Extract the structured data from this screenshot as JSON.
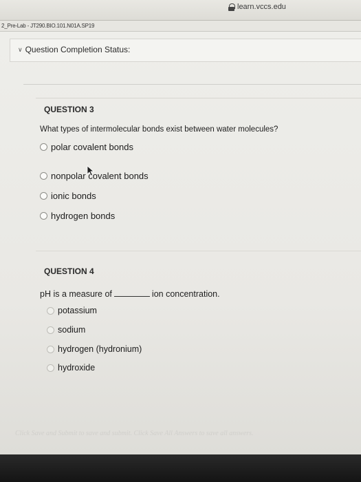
{
  "browser": {
    "url": "learn.vccs.edu"
  },
  "breadcrumb": "2_Pre-Lab - JT290.BIO.101.N01A.SP19",
  "status": {
    "label": "Question Completion Status:"
  },
  "question3": {
    "heading": "QUESTION 3",
    "text": "What types of intermolecular bonds exist between water molecules?",
    "options": [
      "polar covalent bonds",
      "nonpolar covalent bonds",
      "ionic bonds",
      "hydrogen bonds"
    ]
  },
  "question4": {
    "heading": "QUESTION 4",
    "text_before": "pH is a measure of",
    "text_after": "ion concentration.",
    "options": [
      "potassium",
      "sodium",
      "hydrogen (hydronium)",
      "hydroxide"
    ]
  },
  "footer": "Click Save and Submit to save and submit. Click Save All Answers to save all answers."
}
